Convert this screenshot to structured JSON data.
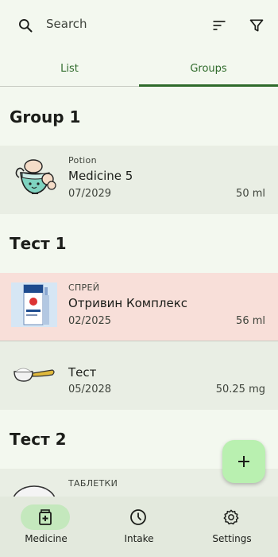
{
  "search": {
    "placeholder": "Search",
    "icon": "search-icon"
  },
  "toolbar": {
    "sort_icon": "sort-icon",
    "filter_icon": "filter-icon"
  },
  "tabs": [
    {
      "label": "List",
      "selected": false
    },
    {
      "label": "Groups",
      "selected": true
    }
  ],
  "groups": [
    {
      "title": "Group 1",
      "items": [
        {
          "form": "Potion",
          "name": "Medicine 5",
          "expiry": "07/2029",
          "amount": "50 ml",
          "expired": false,
          "image": "potion-image"
        }
      ]
    },
    {
      "title": "Тест 1",
      "items": [
        {
          "form": "СПРЕЙ",
          "name": "Отривин Комплекс",
          "expiry": "02/2025",
          "amount": "56 ml",
          "expired": true,
          "image": "spray-box-image"
        },
        {
          "form": "",
          "name": "Тест",
          "expiry": "05/2028",
          "amount": "50.25 mg",
          "expired": false,
          "image": "spoon-image"
        }
      ]
    },
    {
      "title": "Тест 2",
      "items": [
        {
          "form": "ТАБЛЕТКИ",
          "name": "",
          "expiry": "",
          "amount": "",
          "expired": false,
          "image": "tablet-image"
        }
      ]
    }
  ],
  "fab": {
    "label": "+",
    "icon": "add-icon"
  },
  "bottom_nav": [
    {
      "label": "Medicine",
      "icon": "medicine-box-icon",
      "active": true
    },
    {
      "label": "Intake",
      "icon": "clock-icon",
      "active": false
    },
    {
      "label": "Settings",
      "icon": "gear-icon",
      "active": false
    }
  ],
  "colors": {
    "background": "#f3f8ef",
    "accent": "#2f6b2b",
    "card": "#e9eee4",
    "expired_card": "#f8dfd9",
    "fab": "#b9f0b0",
    "nav_active_pill": "#c4e8bd"
  }
}
